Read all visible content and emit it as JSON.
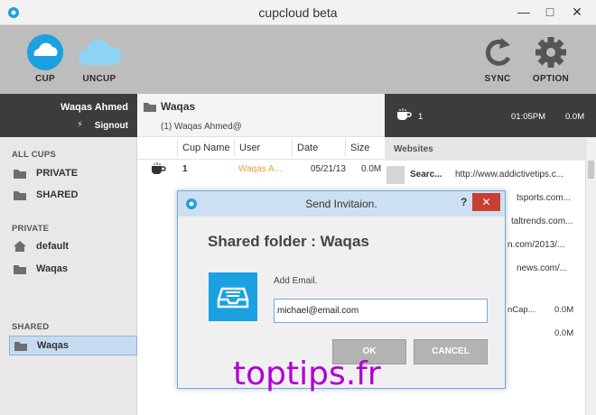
{
  "window": {
    "title": "cupcloud beta",
    "controls": [
      "—",
      "□",
      "✕"
    ]
  },
  "toolbar": {
    "cup_label": "CUP",
    "uncup_label": "UNCUP",
    "sync_label": "SYNC",
    "option_label": "OPTION"
  },
  "user": {
    "name": "Waqas Ahmed",
    "signout_label": "Signout"
  },
  "sidebar": {
    "all_cups_title": "ALL CUPS",
    "all_cups": [
      {
        "label": "PRIVATE"
      },
      {
        "label": "SHARED"
      }
    ],
    "private_title": "PRIVATE",
    "private_items": [
      {
        "label": "default"
      },
      {
        "label": "Waqas"
      }
    ],
    "shared_title": "SHARED",
    "shared_items": [
      {
        "label": "Waqas",
        "selected": true
      }
    ]
  },
  "folder": {
    "name": "Waqas",
    "members": "(1) Waqas Ahmed@"
  },
  "cups_table": {
    "headers": [
      "Cup Name",
      "User",
      "Date",
      "Size"
    ],
    "rows": [
      {
        "name": "1",
        "user": "Waqas A...",
        "date": "05/21/13",
        "size": "0.0M"
      }
    ]
  },
  "right_panel": {
    "cup_name": "1",
    "time": "01:05PM",
    "size": "0.0M",
    "websites_title": "Websites",
    "first_site": {
      "name": "Searc...",
      "url": "http://www.addictivetips.c..."
    },
    "visible_urls": [
      "tsports.com...",
      "taltrends.com...",
      "n.com/2013/...",
      "news.com/..."
    ],
    "more_row": {
      "text": "nCap...",
      "size": "0.0M"
    },
    "last_size": "0.0M"
  },
  "dialog": {
    "title": "Send Invitaion.",
    "help": "?",
    "close": "✕",
    "heading": "Shared folder : Waqas",
    "add_email_label": "Add Email.",
    "email_value": "michael@email.com",
    "ok_label": "OK",
    "cancel_label": "CANCEL"
  },
  "watermark": "toptips.fr",
  "colors": {
    "accent_blue": "#1ba1e2",
    "dark_panel": "#3c3c3c",
    "toolbar_gray": "#bdbdbd",
    "user_orange": "#e8a03a",
    "close_red": "#c84031",
    "watermark_purple": "#b000d0"
  }
}
